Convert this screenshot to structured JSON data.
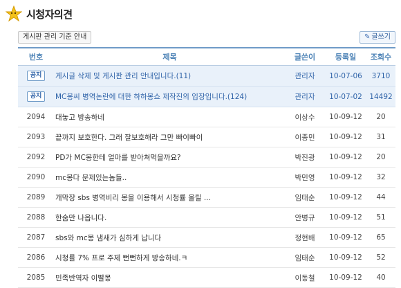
{
  "board": {
    "title": "시청자의견"
  },
  "buttons": {
    "guide": "게시판 관리 기준 안내",
    "write": "글쓰기"
  },
  "icons": {
    "logo": "star-icon",
    "write": "pencil-icon"
  },
  "columns": {
    "no": "번호",
    "title": "제목",
    "writer": "글쓴이",
    "date": "등록일",
    "views": "조회수"
  },
  "notices": [
    {
      "badge": "공지",
      "title": "게시글 삭제 및 게시판 관리 안내입니다.(11)",
      "writer": "관리자",
      "date": "10-07-06",
      "views": "3710"
    },
    {
      "badge": "공지",
      "title": "MC몽씨 병역논란에 대한 하하몽쇼 제작진의 입장입니다.(124)",
      "writer": "관리자",
      "date": "10-07-02",
      "views": "14492"
    }
  ],
  "posts": [
    {
      "no": "2094",
      "title": "대놓고 방송하네",
      "writer": "이상수",
      "date": "10-09-12",
      "views": "20"
    },
    {
      "no": "2093",
      "title": "끝까지 보호한다. 그래 잘보호해라 그만 빠이빠이",
      "writer": "이종민",
      "date": "10-09-12",
      "views": "31"
    },
    {
      "no": "2092",
      "title": "PD가 MC몽한테 얼마를 받아쳐먹을까요?",
      "writer": "박진광",
      "date": "10-09-12",
      "views": "20"
    },
    {
      "no": "2090",
      "title": "mc몽다 문제있는놈들..",
      "writer": "박민영",
      "date": "10-09-12",
      "views": "32"
    },
    {
      "no": "2089",
      "title": "개막장 sbs 병역비리 몽을 이용해서 시청률 올릴 ...",
      "writer": "임태순",
      "date": "10-09-12",
      "views": "44"
    },
    {
      "no": "2088",
      "title": "한숨만 나옵니다.",
      "writer": "안병규",
      "date": "10-09-12",
      "views": "51"
    },
    {
      "no": "2087",
      "title": "sbs와 mc몽 냄새가 심하게 납니다",
      "writer": "정현배",
      "date": "10-09-12",
      "views": "65"
    },
    {
      "no": "2086",
      "title": "시청률 7% 프로 주제 뻔뻔하게 방송하네.ㅋ",
      "writer": "임태순",
      "date": "10-09-12",
      "views": "52"
    },
    {
      "no": "2085",
      "title": "민족반역자 이빨몽",
      "writer": "이동철",
      "date": "10-09-12",
      "views": "40"
    }
  ]
}
